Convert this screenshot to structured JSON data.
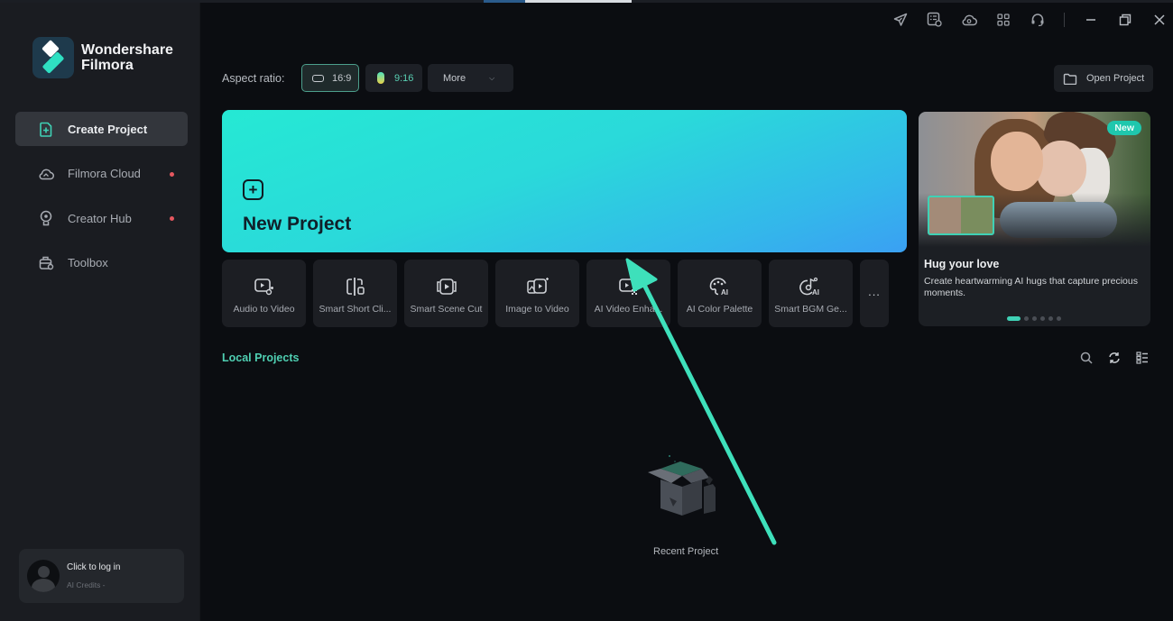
{
  "app": {
    "brand_line1": "Wondershare",
    "brand_line2": "Filmora",
    "accent": "#3fd1b5"
  },
  "sidebar": {
    "items": [
      {
        "label": "Create Project",
        "icon": "create-project-icon",
        "active": true,
        "badge": false
      },
      {
        "label": "Filmora Cloud",
        "icon": "cloud-icon",
        "active": false,
        "badge": true
      },
      {
        "label": "Creator Hub",
        "icon": "creator-hub-icon",
        "active": false,
        "badge": true
      },
      {
        "label": "Toolbox",
        "icon": "toolbox-icon",
        "active": false,
        "badge": false
      }
    ],
    "login": {
      "title": "Click to log in",
      "subtitle": "AI Credits -"
    }
  },
  "titlebar": {
    "icons": [
      "send-icon",
      "task-list-icon",
      "cloud-upload-icon",
      "apps-grid-icon",
      "headset-support-icon",
      "minimize-icon",
      "restore-icon",
      "close-icon"
    ]
  },
  "aspect": {
    "label": "Aspect ratio:",
    "options": [
      {
        "label": "16:9",
        "selected": true
      },
      {
        "label": "9:16",
        "selected": false
      }
    ],
    "more_label": "More"
  },
  "open_project_label": "Open Project",
  "hero": {
    "title": "New Project"
  },
  "tools": [
    {
      "label": "Audio to Video",
      "icon": "audio-to-video-icon"
    },
    {
      "label": "Smart Short Cli...",
      "icon": "smart-short-clip-icon"
    },
    {
      "label": "Smart Scene Cut",
      "icon": "smart-scene-cut-icon"
    },
    {
      "label": "Image to Video",
      "icon": "image-to-video-icon"
    },
    {
      "label": "AI Video Enha...",
      "icon": "ai-video-enhancer-icon"
    },
    {
      "label": "AI Color Palette",
      "icon": "ai-color-palette-icon"
    },
    {
      "label": "Smart BGM Ge...",
      "icon": "smart-bgm-icon"
    }
  ],
  "tools_more_label": "...",
  "promo": {
    "badge": "New",
    "title": "Hug your love",
    "description": "Create heartwarming AI hugs that capture precious moments.",
    "slides_total": 6,
    "slide_active": 1
  },
  "local_projects": {
    "title": "Local Projects",
    "empty_label": "Recent Project"
  }
}
